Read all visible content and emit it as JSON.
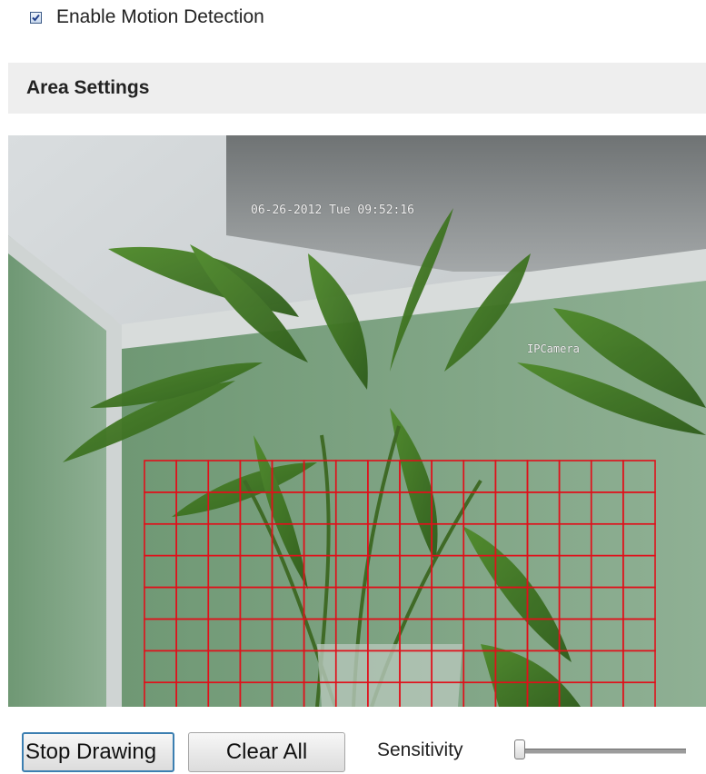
{
  "motion_detection": {
    "enable_label": "Enable Motion Detection",
    "enabled": true
  },
  "area_settings": {
    "title": "Area Settings"
  },
  "video": {
    "osd_timestamp": "06-26-2012 Tue 09:52:16",
    "osd_camera_name": "IPCamera",
    "detection_grid": {
      "columns": 16,
      "rows": 9,
      "color": "#e0101a"
    }
  },
  "controls": {
    "stop_drawing_label": "Stop Drawing",
    "clear_all_label": "Clear All",
    "sensitivity_label": "Sensitivity",
    "sensitivity_level": 0
  },
  "icons": {
    "checkbox": "checkmark-icon"
  }
}
